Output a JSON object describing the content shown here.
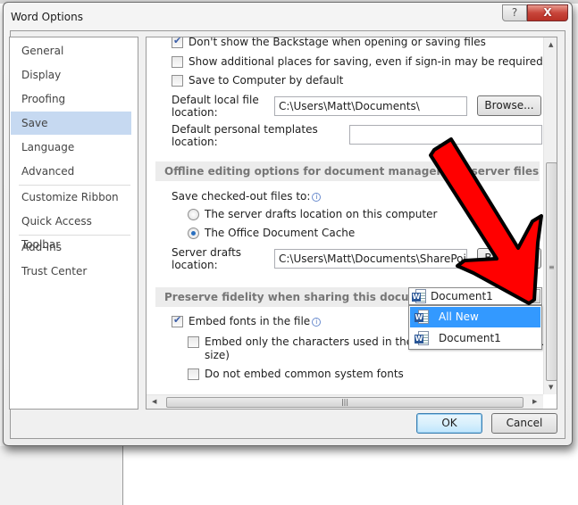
{
  "window": {
    "title": "Word Options",
    "help_label": "?",
    "close_label": "X"
  },
  "sidebar": {
    "items": [
      {
        "label": "General",
        "selected": false
      },
      {
        "label": "Display",
        "selected": false
      },
      {
        "label": "Proofing",
        "selected": false
      },
      {
        "label": "Save",
        "selected": true
      },
      {
        "label": "Language",
        "selected": false
      },
      {
        "label": "Advanced",
        "selected": false
      },
      {
        "label": "Customize Ribbon",
        "selected": false
      },
      {
        "label": "Quick Access Toolbar",
        "selected": false
      },
      {
        "label": "Add-Ins",
        "selected": false
      },
      {
        "label": "Trust Center",
        "selected": false
      }
    ]
  },
  "save": {
    "dont_show_backstage": {
      "label": "Don't show the Backstage when opening or saving files",
      "checked": true
    },
    "show_additional_places": {
      "label": "Show additional places for saving, even if sign-in may be required.",
      "checked": false
    },
    "save_to_computer": {
      "label": "Save to Computer by default",
      "checked": false
    },
    "default_local_location": {
      "label_line1": "Default local file",
      "label_line2": "location:",
      "value": "C:\\Users\\Matt\\Documents\\"
    },
    "browse_label": "Browse...",
    "default_templates_location": {
      "label_line1": "Default personal templates",
      "label_line2": "location:",
      "value": ""
    }
  },
  "offline": {
    "section_title": "Offline editing options for document management server files",
    "save_checked_out_label": "Save checked-out files to:",
    "options": [
      {
        "label": "The server drafts location on this computer",
        "selected": false
      },
      {
        "label": "The Office Document Cache",
        "selected": true
      }
    ],
    "server_drafts": {
      "label_line1": "Server drafts",
      "label_line2": "location:",
      "value": "C:\\Users\\Matt\\Documents\\SharePoint Drafts\\"
    },
    "browse_label": "Browse..."
  },
  "fidelity": {
    "section_title": "Preserve fidelity when sharing this document:",
    "selected_document": "Document1",
    "dropdown_options": [
      {
        "label": "All New Documents",
        "highlighted": true
      },
      {
        "label": "Document1",
        "highlighted": false
      }
    ],
    "embed_fonts": {
      "label": "Embed fonts in the file",
      "checked": true
    },
    "embed_only_used": {
      "label_line1": "Embed only the characters used in the document (best for reducing file",
      "label_line2": "size)",
      "checked": false
    },
    "no_common_fonts": {
      "label": "Do not embed common system fonts",
      "checked": false
    }
  },
  "footer": {
    "ok_label": "OK",
    "cancel_label": "Cancel"
  },
  "annotation": {
    "arrow_color": "#ff0000"
  }
}
